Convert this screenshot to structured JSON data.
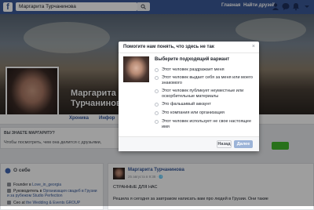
{
  "topbar": {
    "logo": "f",
    "search_value": "Маргарита Турчанинова",
    "home_label": "Главная",
    "find_friends_label": "Найти друзей"
  },
  "profile": {
    "name": "Маргарита Турчанинова",
    "name_line1": "Маргарита",
    "name_line2": "Турчанинова"
  },
  "tabs": [
    "Хроника",
    "Инфор"
  ],
  "know_panel": {
    "title": "ВЫ ЗНАЕТЕ МАРГАРИТУ?",
    "text": "Чтобы посмотреть, чем она делится с друзьями,"
  },
  "about": {
    "title": "О себе",
    "rows": [
      {
        "prefix": "Founder в ",
        "link": "Love_in_georgia"
      },
      {
        "prefix": "Руководитель в ",
        "link": "Организация свадеб в Грузии и за рубежом Studio Perfection"
      },
      {
        "prefix": "Ceo at ",
        "link": "the Wedding & Events GROUP"
      }
    ]
  },
  "post": {
    "author": "Маргарита Турчанинова",
    "date": "25 августа в 9:38 · 🌐",
    "title": "СТРАННЫЕ ДЛЯ НАС",
    "text": "Решила я сегодня за завтраком написать вам про людей в Грузии. Они такие"
  },
  "dialog": {
    "title": "Помогите нам понять, что здесь не так",
    "close": "×",
    "prompt": "Выберите подходящий вариант",
    "options": [
      "Этот человек раздражает меня",
      "Этот человек выдает себя за меня или моего знакомого",
      "Этот человек публикует неуместные или оскорбительные материалы",
      "Это фальшивый аккаунт",
      "Это компания или организация",
      "Этот человек использует не свое настоящее имя"
    ],
    "back_label": "Назад",
    "next_label": "Далее"
  },
  "colors": {
    "brand": "#3b5998",
    "link": "#365899",
    "overlay": "rgba(0,0,0,0.38)",
    "next_disabled": "#9cb4d8",
    "green": "#42b72a"
  }
}
